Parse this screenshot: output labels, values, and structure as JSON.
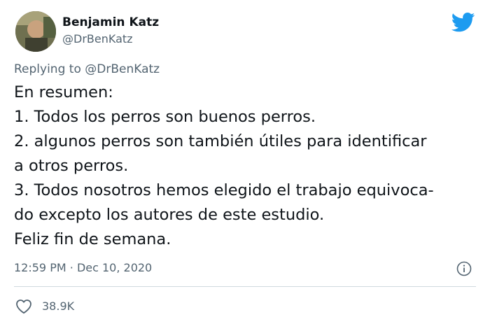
{
  "author": {
    "name": "Benjamin Katz",
    "handle": "@DrBenKatz"
  },
  "reply": {
    "prefix": "Replying to",
    "handle": "@DrBenKatz"
  },
  "tweet": {
    "lines": [
      "En resumen:",
      "1. Todos los perros son buenos perros.",
      "2. algunos perros son también útiles para identificar",
      "a otros perros.",
      "3. Todos nosotros hemos elegido el trabajo equivoca-",
      "do excepto los autores de este estudio.",
      "Feliz fin de semana."
    ],
    "time": "12:59 PM",
    "separator": "·",
    "date": "Dec 10, 2020"
  },
  "stats": {
    "likes": "38.9K"
  },
  "icons": {
    "brand": "twitter-bird-icon",
    "info": "info-icon",
    "like": "heart-icon"
  },
  "colors": {
    "brand": "#1d9bf0",
    "text": "#0f1419",
    "secondary": "#536471",
    "divider": "#cfd9de"
  }
}
